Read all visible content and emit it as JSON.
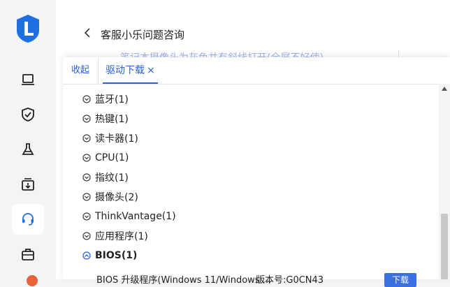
{
  "header": {
    "title": "客服小乐问题咨询",
    "back_icon": "chevron-left-icon",
    "obscured_text": "笔记本摄像头为灰色并有斜线打开(全屏不好使)"
  },
  "rail": {
    "icons": [
      "laptop-icon",
      "shield-check-icon",
      "flask-icon",
      "download-box-icon",
      "headset-icon",
      "toolbox-icon"
    ],
    "active_index": 4,
    "accent": "#2a62d8"
  },
  "panel": {
    "tabs": {
      "collapse_label": "收起",
      "driver_label": "驱动下载",
      "close_glyph": "×"
    },
    "categories": [
      {
        "label": "蓝牙(1)",
        "state": "collapsed"
      },
      {
        "label": "热键(1)",
        "state": "collapsed"
      },
      {
        "label": "读卡器(1)",
        "state": "collapsed"
      },
      {
        "label": "CPU(1)",
        "state": "collapsed"
      },
      {
        "label": "指纹(1)",
        "state": "collapsed"
      },
      {
        "label": "摄像头(2)",
        "state": "collapsed"
      },
      {
        "label": "ThinkVantage(1)",
        "state": "collapsed"
      },
      {
        "label": "应用程序(1)",
        "state": "collapsed"
      },
      {
        "label": "BIOS(1)",
        "state": "expanded"
      }
    ],
    "bios_item": {
      "name": "BIOS 升级程序(Windows 11/Windows ...",
      "version": "版本号:G0CN43",
      "download_label": "下载"
    }
  }
}
